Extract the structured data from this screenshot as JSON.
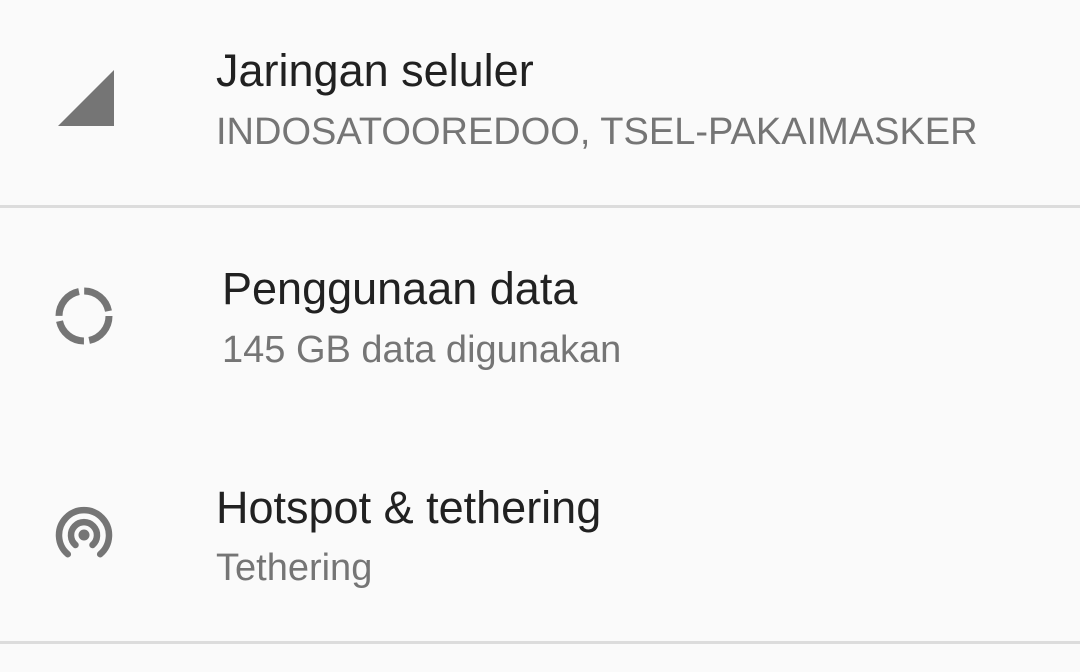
{
  "settings": {
    "items": [
      {
        "icon": "cellular-signal-icon",
        "title": "Jaringan seluler",
        "summary": "INDOSATOOREDOO, TSEL-PAKAIMASKER"
      },
      {
        "icon": "data-usage-icon",
        "title": "Penggunaan data",
        "summary": "145 GB data digunakan"
      },
      {
        "icon": "hotspot-icon",
        "title": "Hotspot & tethering",
        "summary": "Tethering"
      }
    ]
  },
  "colors": {
    "background": "#fafafa",
    "title": "#212121",
    "summary": "#757575",
    "icon": "#757575",
    "divider": "#dcdcdc"
  }
}
